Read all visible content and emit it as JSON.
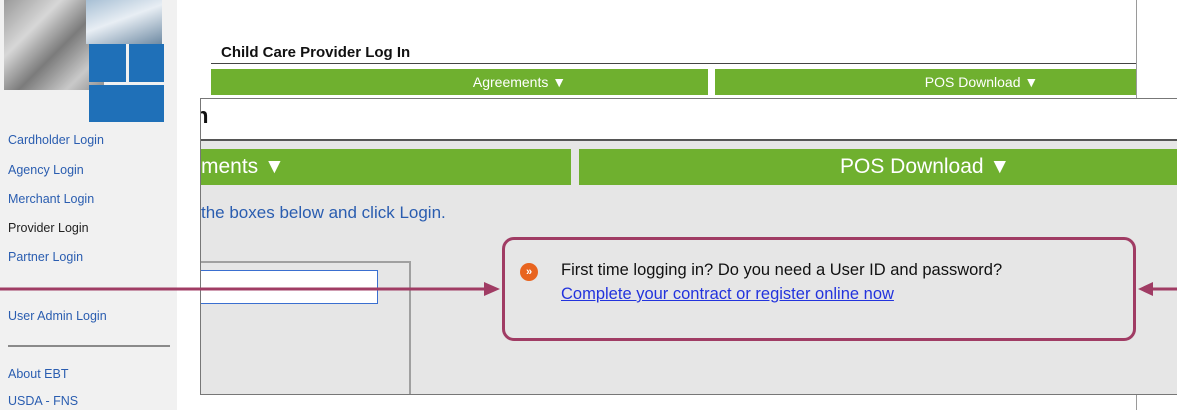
{
  "sidebar": {
    "links": [
      {
        "label": "Cardholder Login",
        "current": false
      },
      {
        "label": "Agency Login",
        "current": false
      },
      {
        "label": "Merchant Login",
        "current": false
      },
      {
        "label": "Provider Login",
        "current": true
      },
      {
        "label": "Partner Login",
        "current": false
      },
      {
        "label": "User Admin Login",
        "current": false
      },
      {
        "label": "About EBT",
        "current": false
      },
      {
        "label": "USDA - FNS",
        "current": false
      }
    ]
  },
  "page": {
    "title": "Child Care Provider Log In",
    "tabs": [
      {
        "label": "Agreements ▼"
      },
      {
        "label": "POS Download ▼"
      }
    ]
  },
  "zoom": {
    "title_fragment": "n",
    "tabs": [
      {
        "label": "ments ▼"
      },
      {
        "label": "POS Download ▼"
      }
    ],
    "instruction": "the boxes below and click Login."
  },
  "callout": {
    "icon": "orange-arrow-bullet-icon",
    "question": "First time logging in? Do you need a User ID and password?",
    "link": "Complete your contract or register online now"
  },
  "colors": {
    "tab_green": "#6fb02f",
    "callout_border": "#a03c64",
    "link_blue": "#2a5db0",
    "bullet_orange": "#e8641f"
  }
}
